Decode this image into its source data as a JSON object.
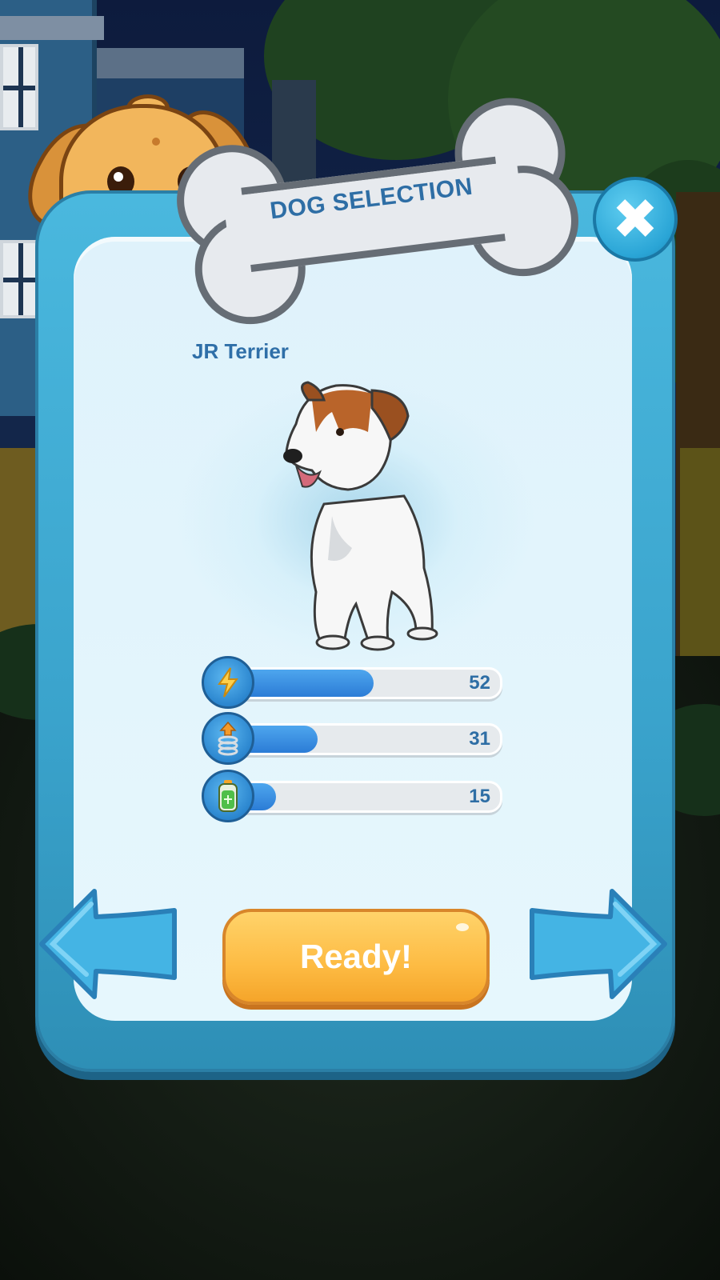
{
  "header": {
    "title": "DOG SELECTION"
  },
  "dog": {
    "name": "JR Terrier"
  },
  "stats": [
    {
      "icon": "lightning-icon",
      "value": "52",
      "fraction": 0.52
    },
    {
      "icon": "spring-jump-icon",
      "value": "31",
      "fraction": 0.31
    },
    {
      "icon": "battery-icon",
      "value": "15",
      "fraction": 0.15
    }
  ],
  "actions": {
    "ready_label": "Ready!"
  },
  "colors": {
    "panel": "#3aa3cc",
    "panel_inner": "#e6f7fd",
    "accent": "#2b7cd6",
    "ready": "#fdbb43"
  }
}
